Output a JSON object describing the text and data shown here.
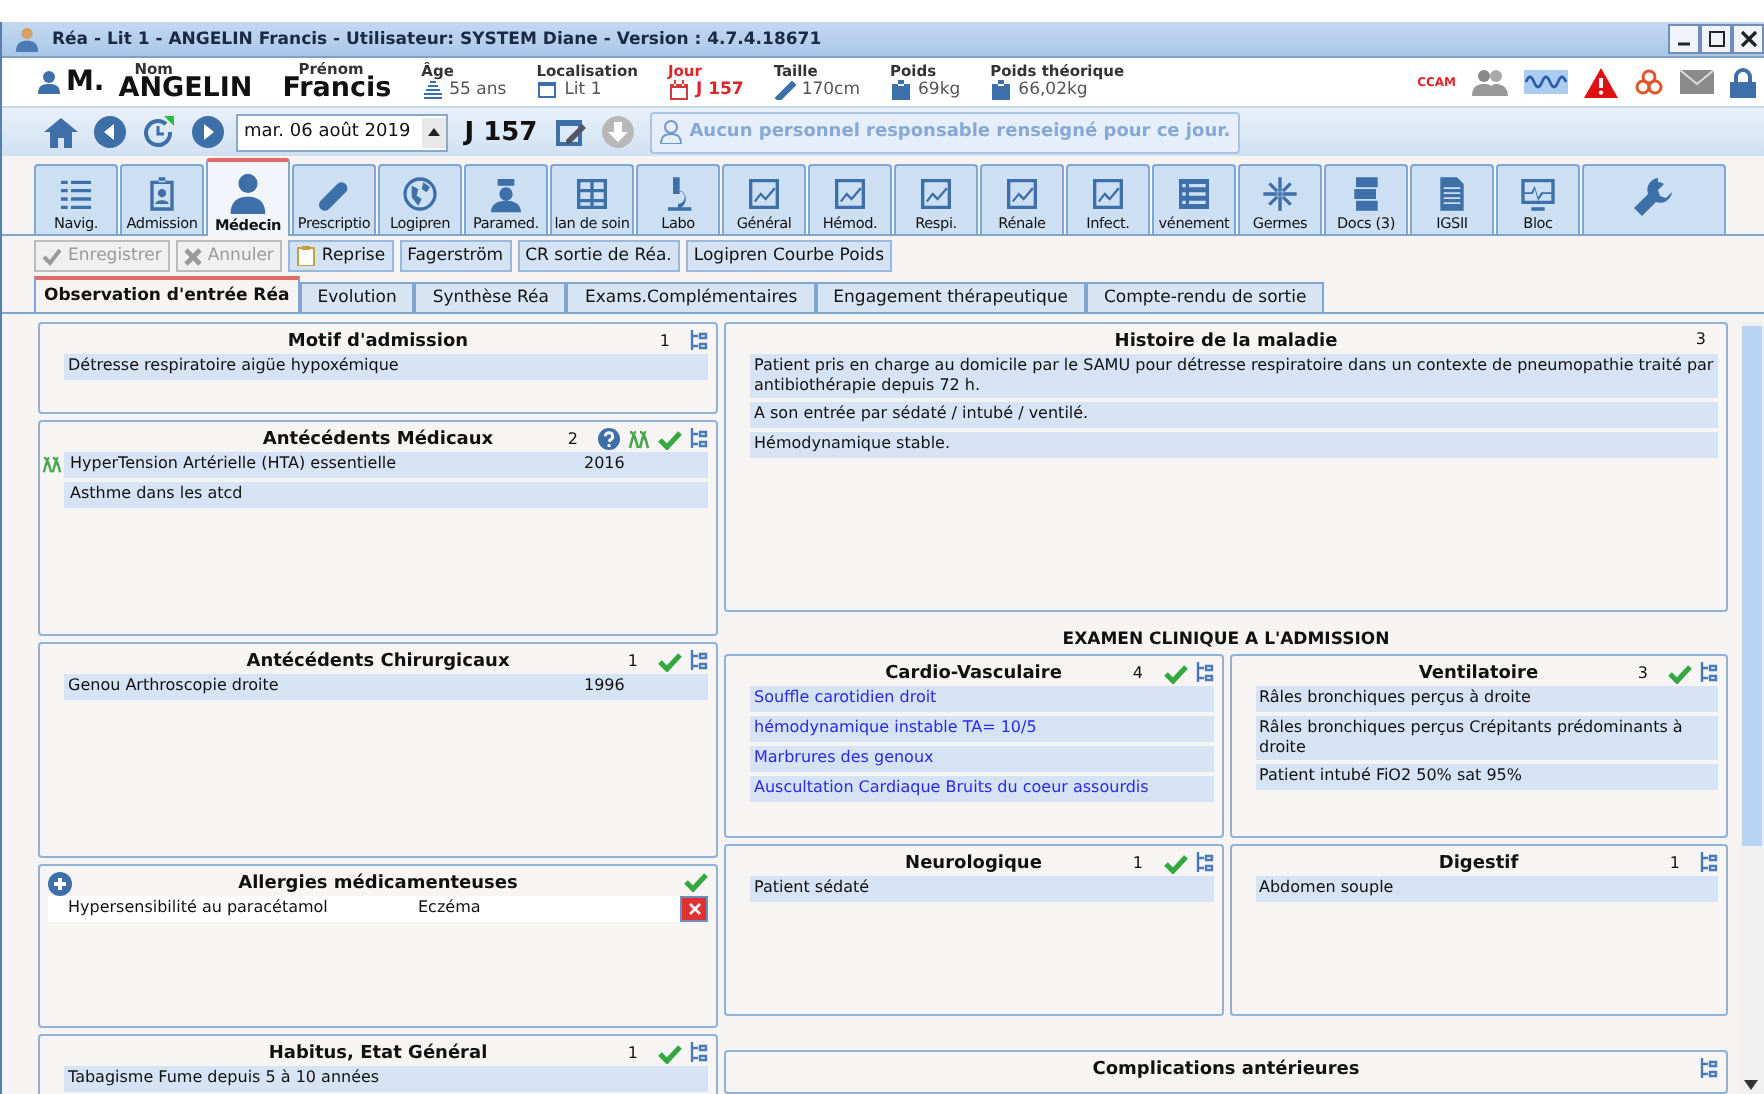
{
  "window": {
    "title": "Réa - Lit 1 - ANGELIN Francis - Utilisateur: SYSTEM Diane - Version : 4.7.4.18671"
  },
  "patient": {
    "civility": "M.",
    "badge": "CCAM",
    "fields": [
      {
        "label": "Nom",
        "value": "ANGELIN",
        "kind": "name"
      },
      {
        "label": "Prénom",
        "value": "Francis",
        "kind": "name"
      },
      {
        "label": "Âge",
        "value": "55 ans",
        "kind": "info"
      },
      {
        "label": "Localisation",
        "value": "Lit 1",
        "kind": "info"
      },
      {
        "label": "Jour",
        "value": "J 157",
        "kind": "alert"
      },
      {
        "label": "Taille",
        "value": "170cm",
        "kind": "info"
      },
      {
        "label": "Poids",
        "value": "69kg",
        "kind": "info"
      },
      {
        "label": "Poids théorique",
        "value": "66,02kg",
        "kind": "info"
      }
    ]
  },
  "nav": {
    "date": "mar. 06 août 2019",
    "day": "J 157",
    "responsible": "Aucun personnel responsable renseigné pour ce jour."
  },
  "modules": [
    {
      "label": "Navig.",
      "selected": false
    },
    {
      "label": "Admission",
      "selected": false
    },
    {
      "label": "Médecin",
      "selected": true
    },
    {
      "label": "Prescriptio",
      "selected": false
    },
    {
      "label": "Logipren",
      "selected": false
    },
    {
      "label": "Paramed.",
      "selected": false
    },
    {
      "label": "lan de soin",
      "selected": false
    },
    {
      "label": "Labo",
      "selected": false
    },
    {
      "label": "Général",
      "selected": false
    },
    {
      "label": "Hémod.",
      "selected": false
    },
    {
      "label": "Respi.",
      "selected": false
    },
    {
      "label": "Rénale",
      "selected": false
    },
    {
      "label": "Infect.",
      "selected": false
    },
    {
      "label": "vénement",
      "selected": false
    },
    {
      "label": "Germes",
      "selected": false
    },
    {
      "label": "Docs (3)",
      "selected": false
    },
    {
      "label": "IGSII",
      "selected": false
    },
    {
      "label": "Bloc",
      "selected": false
    },
    {
      "selected": false
    }
  ],
  "actions": [
    {
      "label": "Enregistrer",
      "disabled": true
    },
    {
      "label": "Annuler",
      "disabled": true
    },
    {
      "label": "Reprise",
      "disabled": false
    },
    {
      "label": "Fagerström",
      "disabled": false
    },
    {
      "label": "CR sortie de Réa.",
      "disabled": false
    },
    {
      "label": "Logipren Courbe Poids",
      "disabled": false
    }
  ],
  "subtabs": [
    {
      "label": "Observation d'entrée Réa",
      "selected": true
    },
    {
      "label": "Evolution",
      "selected": false
    },
    {
      "label": "Synthèse Réa",
      "selected": false
    },
    {
      "label": "Exams.Complémentaires",
      "selected": false
    },
    {
      "label": "Engagement thérapeutique",
      "selected": false
    },
    {
      "label": "Compte-rendu de sortie",
      "selected": false
    }
  ],
  "left_panels": [
    {
      "title": "Motif d'admission",
      "kind": "standard",
      "count": "1",
      "validated": false,
      "rows": [
        {
          "cells": [
            "Détresse respiratoire aigüe hypoxémique"
          ]
        }
      ]
    },
    {
      "title": "Antécédents Médicaux",
      "kind": "history",
      "count": "2",
      "validated": true,
      "rows": [
        {
          "cells": [
            "HyperTension Artérielle (HTA) essentielle",
            "2016"
          ],
          "genetic": true
        },
        {
          "cells": [
            "Asthme dans les atcd"
          ]
        }
      ]
    },
    {
      "title": "Antécédents Chirurgicaux",
      "kind": "standard",
      "count": "1",
      "validated": true,
      "rows": [
        {
          "cells": [
            "Genou Arthroscopie droite",
            "1996"
          ]
        }
      ]
    },
    {
      "title": "Allergies médicamenteuses",
      "kind": "allergy",
      "validated": true,
      "rows": [
        {
          "cells": [
            "Hypersensibilité au paracétamol",
            "Eczéma"
          ]
        }
      ]
    },
    {
      "title": "Habitus, Etat Général",
      "kind": "standard",
      "count": "1",
      "validated": true,
      "rows": [
        {
          "cells": [
            "Tabagisme Fume depuis 5 à 10 années"
          ]
        }
      ]
    }
  ],
  "history": {
    "title": "Histoire de la maladie",
    "count": "3",
    "rows": [
      {
        "cells": [
          "Patient pris en charge au domicile par le SAMU pour détresse respiratoire dans un contexte de pneumopathie traité par antibiothérapie depuis 72 h."
        ]
      },
      {
        "cells": [
          "A son entrée par sédaté / intubé / ventilé."
        ]
      },
      {
        "cells": [
          "Hémodynamique stable."
        ]
      }
    ]
  },
  "exam": {
    "title": "EXAMEN CLINIQUE A L'ADMISSION",
    "panels": [
      {
        "title": "Cardio-Vasculaire",
        "kind": "standard",
        "count": "4",
        "validated": true,
        "rows": [
          {
            "cells": [
              "Souffle carotidien droit"
            ],
            "color": "#2a2ae6"
          },
          {
            "cells": [
              "hémodynamique instable TA= 10/5"
            ],
            "color": "#2a2ae6"
          },
          {
            "cells": [
              "Marbrures des genoux"
            ],
            "color": "#2a2ae6"
          },
          {
            "cells": [
              "Auscultation Cardiaque Bruits du coeur assourdis"
            ],
            "color": "#2a2ae6"
          }
        ]
      },
      {
        "title": "Ventilatoire",
        "kind": "standard",
        "count": "3",
        "validated": true,
        "rows": [
          {
            "cells": [
              "Râles bronchiques perçus à droite"
            ]
          },
          {
            "cells": [
              "Râles bronchiques perçus Crépitants prédominants à droite"
            ]
          },
          {
            "cells": [
              "Patient intubé FiO2 50% sat 95%"
            ]
          }
        ]
      },
      {
        "title": "Neurologique",
        "kind": "standard",
        "count": "1",
        "validated": true,
        "rows": [
          {
            "cells": [
              "Patient sédaté"
            ]
          }
        ]
      },
      {
        "title": "Digestif",
        "kind": "standard",
        "count": "1",
        "validated": false,
        "rows": [
          {
            "cells": [
              "Abdomen souple"
            ]
          }
        ]
      }
    ]
  },
  "complications": {
    "title": "Complications antérieures",
    "kind": "standard"
  }
}
